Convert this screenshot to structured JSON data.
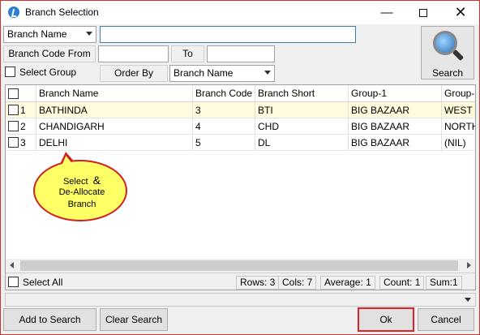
{
  "window": {
    "title": "Branch Selection",
    "minimize": "—",
    "close": "✕"
  },
  "filter": {
    "field_select": "Branch Name",
    "search_value": "",
    "code_from_label": "Branch Code From",
    "code_from_value": "",
    "to_label": "To",
    "to_value": "",
    "select_group_label": "Select Group",
    "order_by_label": "Order By",
    "order_by_select": "Branch Name",
    "search_button": "Search"
  },
  "grid": {
    "columns": [
      "Branch Name",
      "Branch Code",
      "Branch Short",
      "Group-1",
      "Group-"
    ],
    "rows": [
      {
        "num": "1",
        "name": "BATHINDA",
        "code": "3",
        "short": "BTI",
        "group1": "BIG BAZAAR",
        "group2": "WEST"
      },
      {
        "num": "2",
        "name": "CHANDIGARH",
        "code": "4",
        "short": "CHD",
        "group1": "BIG BAZAAR",
        "group2": "NORTH"
      },
      {
        "num": "3",
        "name": "DELHI",
        "code": "5",
        "short": "DL",
        "group1": "BIG BAZAAR",
        "group2": "(NIL)"
      }
    ]
  },
  "callout": {
    "line1": "Select",
    "amp": "&",
    "line2": "De-Allocate",
    "line3": "Branch"
  },
  "status": {
    "select_all": "Select All",
    "rows": "Rows: 3",
    "cols": "Cols: 7",
    "average": "Average: 1",
    "count": "Count: 1",
    "sum": "Sum:1"
  },
  "buttons": {
    "add_to_search": "Add to Search",
    "clear_search": "Clear Search",
    "ok": "Ok",
    "cancel": "Cancel"
  },
  "colors": {
    "accent_border": "#e0202a",
    "selected_row": "#fffbdc",
    "callout_fill": "#ffff66"
  }
}
